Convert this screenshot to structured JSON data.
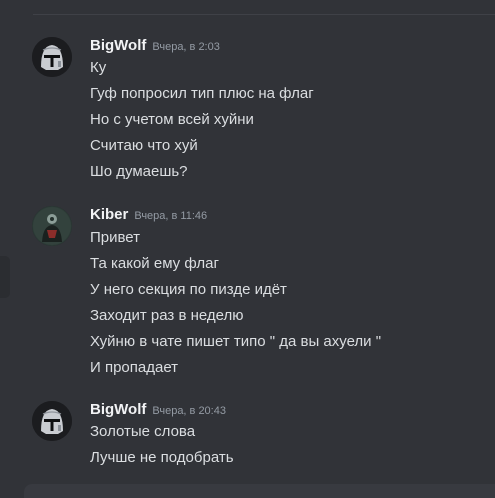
{
  "messages": [
    {
      "author": "BigWolf",
      "avatar": "mandalorian-helmet-avatar",
      "timestamp": "Вчера, в 2:03",
      "lines": [
        "Ку",
        "Гуф попросил тип плюс на флаг",
        "Но с учетом всей хуйни",
        "Считаю что хуй",
        "Шо думаешь?"
      ]
    },
    {
      "author": "Kiber",
      "avatar": "dark-figure-avatar",
      "timestamp": "Вчера, в 11:46",
      "lines": [
        "Привет",
        "Та какой ему флаг",
        "У него секция по пизде идёт",
        "Заходит раз в неделю",
        "Хуйню в чате пишет типо \" да вы ахуели \"",
        "И пропадает"
      ]
    },
    {
      "author": "BigWolf",
      "avatar": "mandalorian-helmet-avatar",
      "timestamp": "Вчера, в 20:43",
      "lines": [
        "Золотые слова",
        "Лучше не подобрать"
      ]
    }
  ],
  "colors": {
    "background": "#313338",
    "author": "#f2f3f5",
    "text": "#dbdee1",
    "timestamp": "#949ba4"
  }
}
